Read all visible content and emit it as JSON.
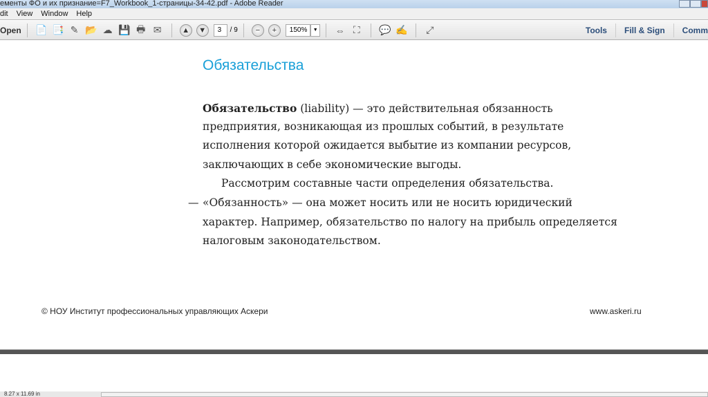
{
  "window": {
    "title": "ементы ФО и их признание=F7_Workbook_1-страницы-34-42.pdf - Adobe Reader"
  },
  "menu": [
    "dit",
    "View",
    "Window",
    "Help"
  ],
  "toolbar": {
    "open": "Open",
    "page_current": "3",
    "page_total": "/ 9",
    "zoom": "150%",
    "tools": "Tools",
    "fill_sign": "Fill & Sign",
    "comment": "Comm"
  },
  "document": {
    "heading": "Обязательства",
    "lines": [
      {
        "bold": "Обязательство",
        "text": " (liability) — это действительная обязанность"
      },
      {
        "text": "предприятия, возникающая из прошлых событий, в результате"
      },
      {
        "text": "исполнения которой ожидается выбытие из компании ресурсов,"
      },
      {
        "text": "заключающих в себе экономические выгоды."
      },
      {
        "text": "Рассмотрим составные части определения обязательства."
      },
      {
        "text": "«Обязанность» — она может носить или не носить юридический"
      },
      {
        "text": "характер. Например, обязательство по налогу на прибыль определяется"
      },
      {
        "text": "налоговым законодательством."
      }
    ],
    "dash": "—",
    "footer_left": "© НОУ Институт профессиональных управляющих Аскери",
    "footer_right": "www.askeri.ru"
  },
  "status": {
    "page_size": "8.27 x 11.69 in"
  }
}
